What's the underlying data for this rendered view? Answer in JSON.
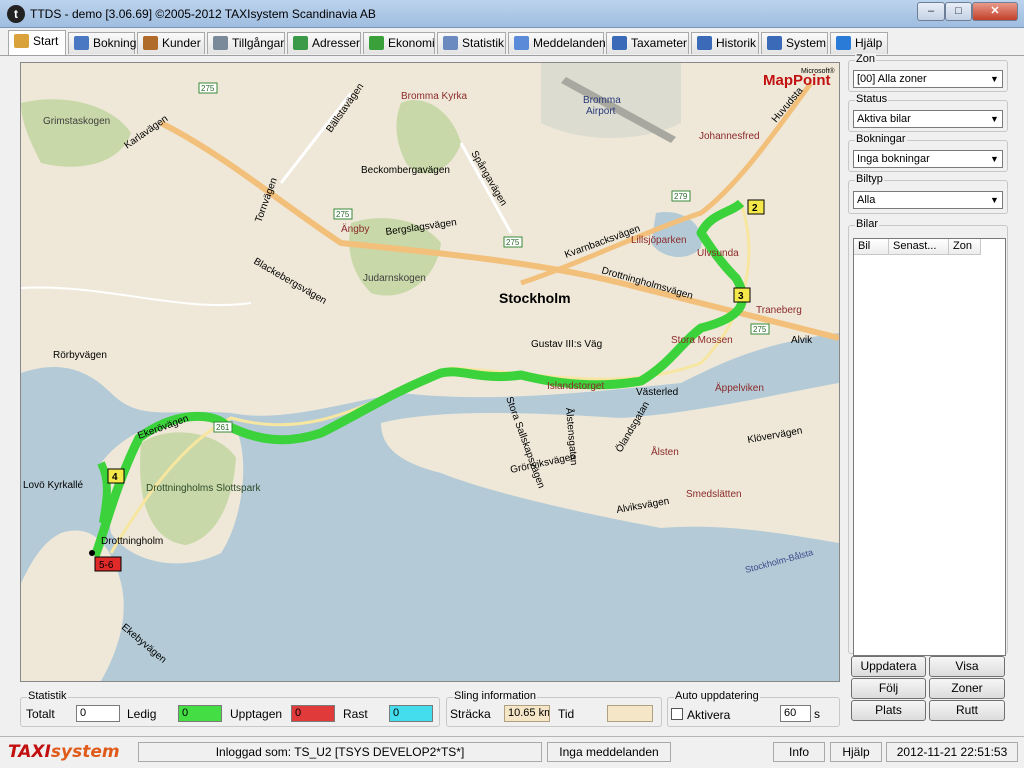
{
  "window": {
    "title": "TTDS - demo [3.06.69] ©2005-2012 TAXIsystem Scandinavia AB",
    "app_icon": "t",
    "buttons": {
      "minimize": "–",
      "maximize": "□",
      "close": "✕"
    }
  },
  "tabs": [
    {
      "label": "Start",
      "icon": "home-icon",
      "color": "#d9a23a"
    },
    {
      "label": "Bokning",
      "icon": "booking-icon",
      "color": "#4a78c2"
    },
    {
      "label": "Kunder",
      "icon": "customers-icon",
      "color": "#b06a2a"
    },
    {
      "label": "Tillgångar",
      "icon": "assets-icon",
      "color": "#7a8a9a"
    },
    {
      "label": "Adresser",
      "icon": "addresses-icon",
      "color": "#3a9a4a"
    },
    {
      "label": "Ekonomi",
      "icon": "economy-icon",
      "color": "#3aa03a"
    },
    {
      "label": "Statistik",
      "icon": "statistics-icon",
      "color": "#6a8ac0"
    },
    {
      "label": "Meddelanden",
      "icon": "messages-icon",
      "color": "#5a8ad8"
    },
    {
      "label": "Taxameter",
      "icon": "taxameter-icon",
      "color": "#3a6ab8"
    },
    {
      "label": "Historik",
      "icon": "history-icon",
      "color": "#3a6ab8"
    },
    {
      "label": "System",
      "icon": "system-icon",
      "color": "#3a6ab8"
    },
    {
      "label": "Hjälp",
      "icon": "help-icon",
      "color": "#2a7ad8"
    }
  ],
  "map": {
    "brand": "MapPoint",
    "brand_super": "Microsoft®",
    "city": "Stockholm",
    "labels": [
      "Grimstaskogen",
      "Bromma Kyrka",
      "Bromma",
      "Airport",
      "Johannesfred",
      "Beckombergavägen",
      "Spångavägen",
      "Bergslagsvägen",
      "Ängby",
      "Judarnskogen",
      "Lillsjöparken",
      "Ulvsunda",
      "Drottningholmsvägen",
      "Traneberg",
      "Alvik",
      "Gustav III:s Väg",
      "Stora Mossen",
      "Äppelviken",
      "Rörbyvägen",
      "Ekerövägen",
      "Drottningholms Slottspark",
      "Lovö Kyrkallé",
      "Drottningholm",
      "Västerled",
      "Ålsten",
      "Smedslätten",
      "Alviksvägen",
      "Grönviksvägen",
      "Blackebergsvägen",
      "Kvarnbacksvägen",
      "Bällstavägen",
      "Huvudsta",
      "Stockholm-Bålsta",
      "Klövervägen",
      "Ekebyvägen",
      "Karlavägen",
      "Islandstorget",
      "Stora Sallskapsvägen",
      "Tornvägen",
      "Ölandsgatan",
      "Ålstensgatan"
    ],
    "roads": [
      "275",
      "275",
      "275",
      "275",
      "279",
      "261"
    ],
    "markers": [
      {
        "label": "2"
      },
      {
        "label": "3"
      },
      {
        "label": "4"
      },
      {
        "label": "5-6"
      }
    ],
    "route_color": "#3cd23c"
  },
  "side": {
    "zon": {
      "label": "Zon",
      "value": "[00] Alla zoner"
    },
    "status": {
      "label": "Status",
      "value": "Aktiva bilar"
    },
    "bokningar": {
      "label": "Bokningar",
      "value": "Inga bokningar"
    },
    "biltyp": {
      "label": "Biltyp",
      "value": "Alla"
    },
    "bilar": {
      "label": "Bilar",
      "columns": [
        "Bil",
        "Senast...",
        "Zon"
      ]
    },
    "buttons": {
      "update": "Uppdatera",
      "show": "Visa",
      "follow": "Följ",
      "zones": "Zoner",
      "place": "Plats",
      "route": "Rutt"
    }
  },
  "statistik": {
    "label": "Statistik",
    "totalt_label": "Totalt",
    "totalt": "0",
    "ledig_label": "Ledig",
    "ledig": "0",
    "ledig_color": "#44dd44",
    "upptagen_label": "Upptagen",
    "upptagen": "0",
    "upptagen_color": "#e03a3a",
    "rast_label": "Rast",
    "rast": "0",
    "rast_color": "#44ddee"
  },
  "sling": {
    "label": "Sling information",
    "stracka_label": "Sträcka",
    "stracka": "10.65 km",
    "tid_label": "Tid",
    "tid": ""
  },
  "auto": {
    "label": "Auto uppdatering",
    "aktivera_label": "Aktivera",
    "interval": "60",
    "unit": "s"
  },
  "statusbar": {
    "logo_a": "TAXI",
    "logo_b": "system",
    "user": "Inloggad som: TS_U2 [TSYS DEVELOP2*TS*]",
    "messages": "Inga meddelanden",
    "info": "Info",
    "help": "Hjälp",
    "datetime": "2012-11-21 22:51:53"
  }
}
